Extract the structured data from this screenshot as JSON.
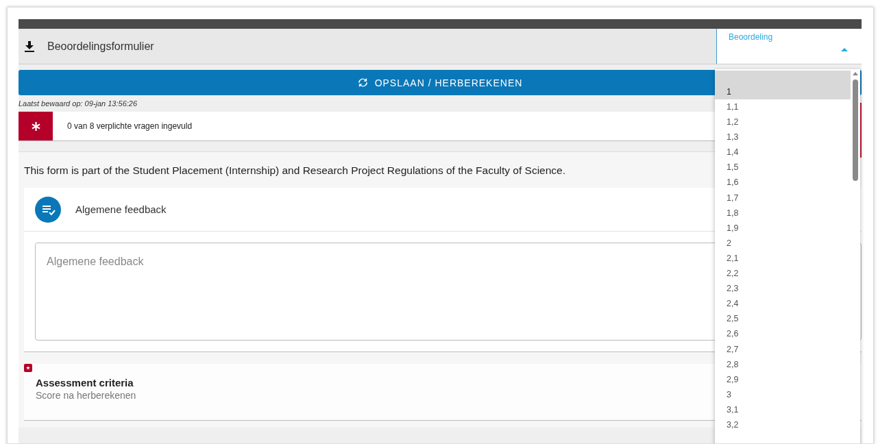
{
  "header": {
    "title": "Beoordelingsformulier"
  },
  "grade_select": {
    "label": "Beoordeling",
    "expanded": true
  },
  "save_button": {
    "label": "OPSLAAN / HERBEREKENEN"
  },
  "last_saved": "Laatst bewaard op: 09-jan 13:56:26",
  "required_status": {
    "text": "0 van 8 verplichte vragen ingevuld"
  },
  "intro": "This form is part of the Student Placement (Internship) and Research Project Regulations of the Faculty of Science.",
  "feedback_card": {
    "title": "Algemene feedback",
    "placeholder": "Algemene feedback"
  },
  "assessment_card": {
    "required": true,
    "title": "Assessment criteria",
    "subtitle": "Score na herberekenen"
  },
  "grade_options": [
    {
      "label": "1",
      "selected": true
    },
    {
      "label": "1,1",
      "selected": false
    },
    {
      "label": "1,2",
      "selected": false
    },
    {
      "label": "1,3",
      "selected": false
    },
    {
      "label": "1,4",
      "selected": false
    },
    {
      "label": "1,5",
      "selected": false
    },
    {
      "label": "1,6",
      "selected": false
    },
    {
      "label": "1,7",
      "selected": false
    },
    {
      "label": "1,8",
      "selected": false
    },
    {
      "label": "1,9",
      "selected": false
    },
    {
      "label": "2",
      "selected": false
    },
    {
      "label": "2,1",
      "selected": false
    },
    {
      "label": "2,2",
      "selected": false
    },
    {
      "label": "2,3",
      "selected": false
    },
    {
      "label": "2,4",
      "selected": false
    },
    {
      "label": "2,5",
      "selected": false
    },
    {
      "label": "2,6",
      "selected": false
    },
    {
      "label": "2,7",
      "selected": false
    },
    {
      "label": "2,8",
      "selected": false
    },
    {
      "label": "2,9",
      "selected": false
    },
    {
      "label": "3",
      "selected": false
    },
    {
      "label": "3,1",
      "selected": false
    },
    {
      "label": "3,2",
      "selected": false
    }
  ]
}
